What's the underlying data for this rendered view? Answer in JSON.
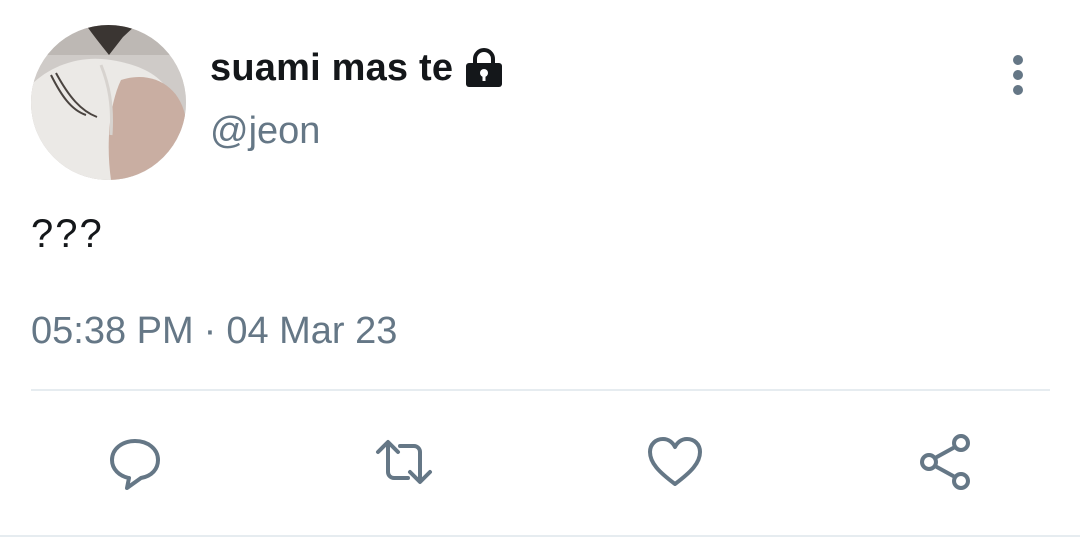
{
  "tweet": {
    "display_name": "suami mas te",
    "handle": "@jeon",
    "text": "???",
    "time": "05:38 PM",
    "separator": "·",
    "date": "04 Mar 23",
    "protected_icon": "lock-icon",
    "more_icon": "vertical-dots-icon"
  },
  "actions": [
    {
      "name": "reply",
      "icon": "speech-bubble-icon"
    },
    {
      "name": "retweet",
      "icon": "retweet-icon"
    },
    {
      "name": "like",
      "icon": "heart-icon"
    },
    {
      "name": "share",
      "icon": "share-icon"
    }
  ],
  "colors": {
    "text_primary": "#14171a",
    "text_secondary": "#657786",
    "divider": "#e6ecf0"
  }
}
